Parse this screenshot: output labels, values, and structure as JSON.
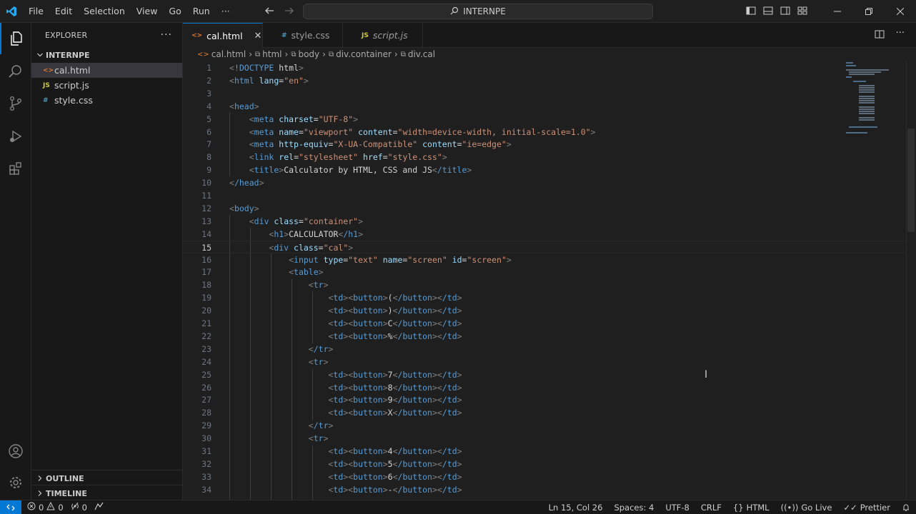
{
  "titlebar": {
    "menu": [
      "File",
      "Edit",
      "Selection",
      "View",
      "Go",
      "Run",
      "···"
    ],
    "search_text": "INTERNPE"
  },
  "sidebar": {
    "title": "EXPLORER",
    "folder": "INTERNPE",
    "files": [
      {
        "name": "cal.html",
        "icon": "<>"
      },
      {
        "name": "script.js",
        "icon": "JS"
      },
      {
        "name": "style.css",
        "icon": "#"
      }
    ],
    "outline": "OUTLINE",
    "timeline": "TIMELINE"
  },
  "tabs": [
    {
      "label": "cal.html",
      "icon": "<>"
    },
    {
      "label": "style.css",
      "icon": "#"
    },
    {
      "label": "script.js",
      "icon": "JS"
    }
  ],
  "breadcrumb": [
    "cal.html",
    "html",
    "body",
    "div.container",
    "div.cal"
  ],
  "editor": {
    "current_line": 15,
    "lines": [
      "<!DOCTYPE html>",
      "<html lang=\"en\">",
      "",
      "<head>",
      "    <meta charset=\"UTF-8\">",
      "    <meta name=\"viewport\" content=\"width=device-width, initial-scale=1.0\">",
      "    <meta http-equiv=\"X-UA-Compatible\" content=\"ie=edge\">",
      "    <link rel=\"stylesheet\" href=\"style.css\">",
      "    <title>Calculator by HTML, CSS and JS</title>",
      "</head>",
      "",
      "<body>",
      "    <div class=\"container\">",
      "        <h1>CALCULATOR</h1>",
      "        <div class=\"cal\">",
      "            <input type=\"text\" name=\"screen\" id=\"screen\">",
      "            <table>",
      "                <tr>",
      "                    <td><button>(</button></td>",
      "                    <td><button>)</button></td>",
      "                    <td><button>C</button></td>",
      "                    <td><button>%</button></td>",
      "                </tr>",
      "                <tr>",
      "                    <td><button>7</button></td>",
      "                    <td><button>8</button></td>",
      "                    <td><button>9</button></td>",
      "                    <td><button>X</button></td>",
      "                </tr>",
      "                <tr>",
      "                    <td><button>4</button></td>",
      "                    <td><button>5</button></td>",
      "                    <td><button>6</button></td>",
      "                    <td><button>-</button></td>"
    ]
  },
  "statusbar": {
    "errors": "0",
    "warnings": "0",
    "ports": "0",
    "position": "Ln 15, Col 26",
    "spaces": "Spaces: 4",
    "encoding": "UTF-8",
    "eol": "CRLF",
    "language": "HTML",
    "golive": "Go Live",
    "prettier": "Prettier"
  },
  "colors": {
    "accent": "#0078d4",
    "html_icon": "#e37933",
    "js_icon": "#cbcb41",
    "css_icon": "#519aba",
    "tag": "#569cd6",
    "attr": "#9cdcfe",
    "string": "#ce9178"
  }
}
